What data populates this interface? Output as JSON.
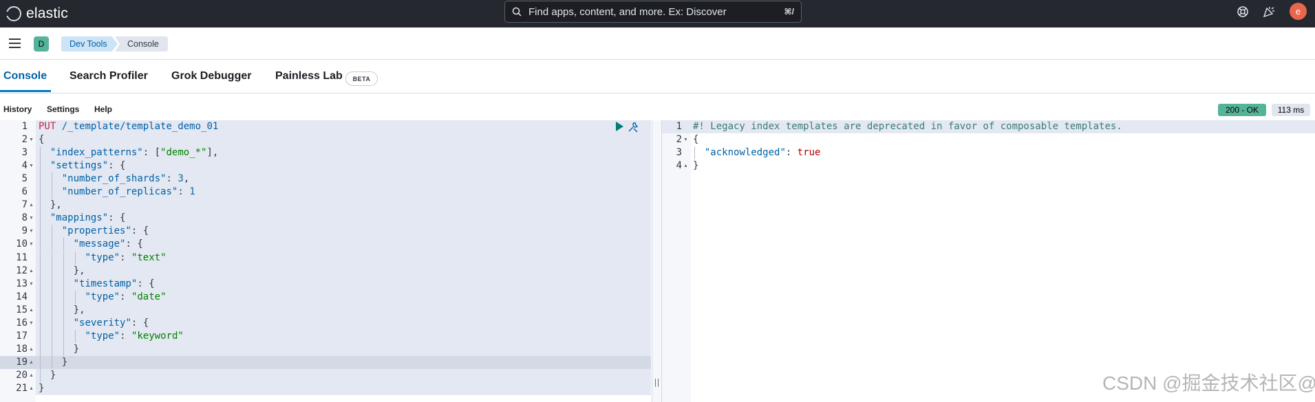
{
  "app": {
    "logo_text": "elastic",
    "search_placeholder": "Find apps, content, and more. Ex: Discover",
    "search_shortcut": "⌘/",
    "avatar_initial": "e"
  },
  "header": {
    "space_initial": "D",
    "breadcrumbs": [
      "Dev Tools",
      "Console"
    ]
  },
  "tabs": [
    {
      "label": "Console",
      "active": true
    },
    {
      "label": "Search Profiler"
    },
    {
      "label": "Grok Debugger"
    },
    {
      "label": "Painless Lab",
      "badge": "BETA"
    }
  ],
  "submenu": [
    "History",
    "Settings",
    "Help"
  ],
  "response_status": {
    "code": "200 - OK",
    "time": "113 ms",
    "color": "#54b399"
  },
  "request_lines": [
    "PUT /_template/template_demo_01",
    "{",
    "  \"index_patterns\": [\"demo_*\"],",
    "  \"settings\": {",
    "    \"number_of_shards\": 3,",
    "    \"number_of_replicas\": 1",
    "  },",
    "  \"mappings\": {",
    "    \"properties\": {",
    "      \"message\": {",
    "        \"type\": \"text\"",
    "      },",
    "      \"timestamp\": {",
    "        \"type\": \"date\"",
    "      },",
    "      \"severity\": {",
    "        \"type\": \"keyword\"",
    "      }",
    "    }",
    "  }",
    "}"
  ],
  "response_lines": [
    "#! Legacy index templates are deprecated in favor of composable templates.",
    "{",
    "  \"acknowledged\": true",
    "}"
  ],
  "watermark": "CSDN @掘金技术社区@Andyat"
}
